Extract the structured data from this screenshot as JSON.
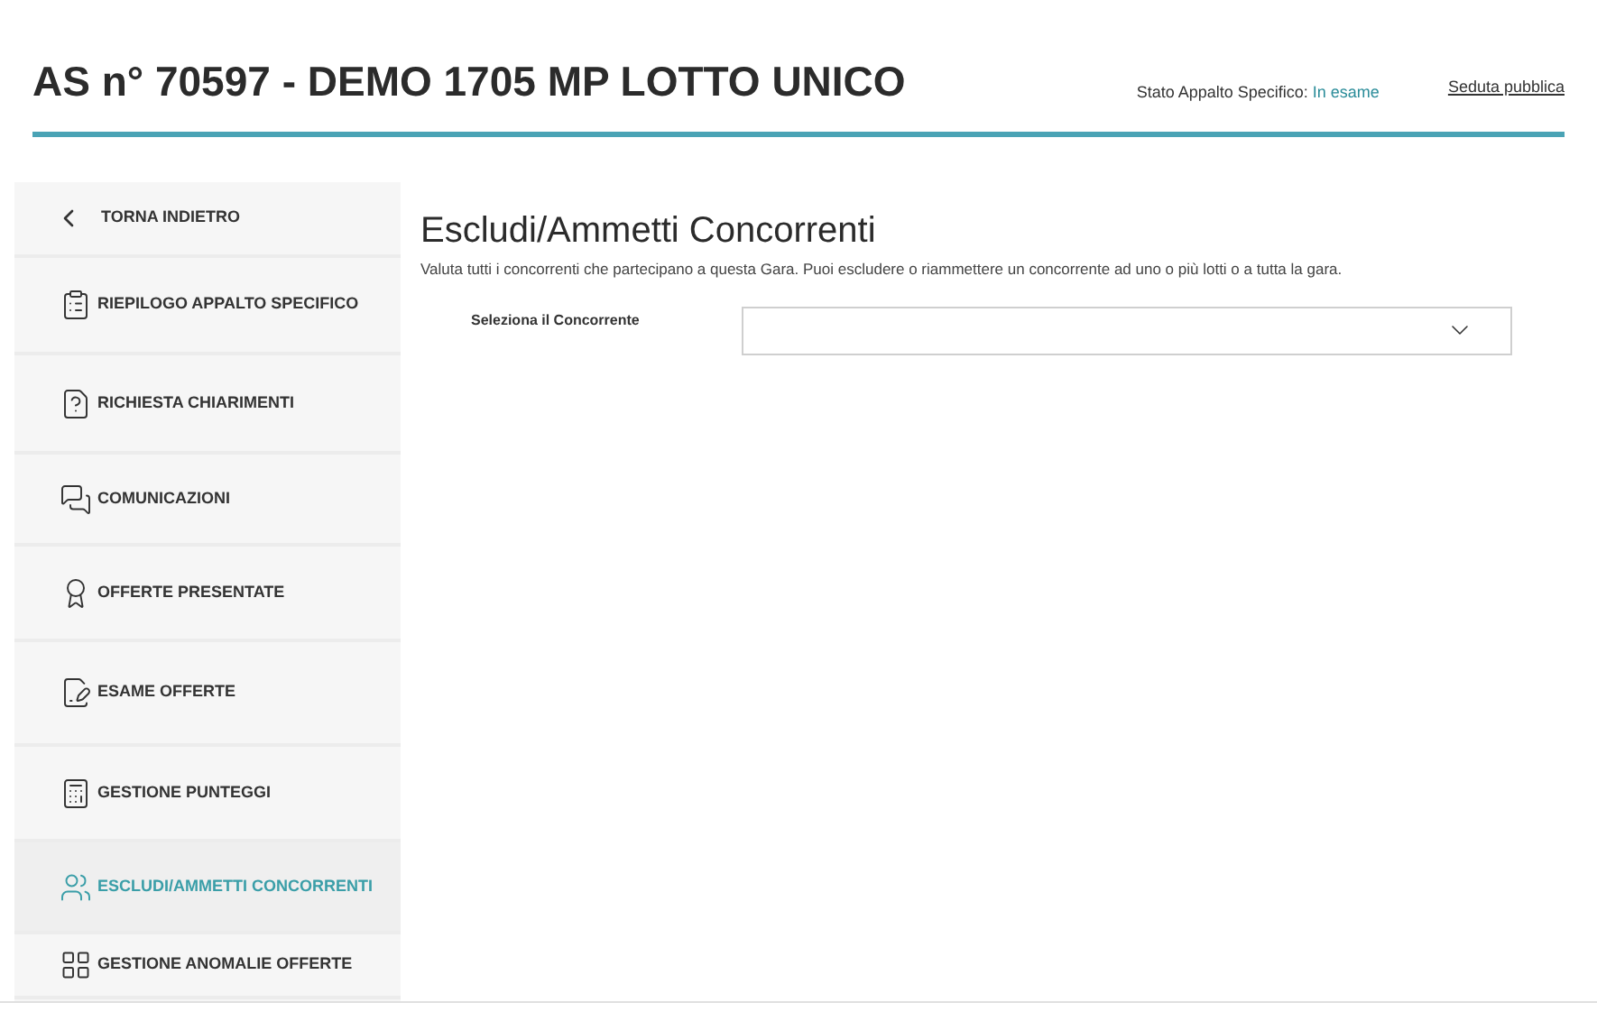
{
  "header": {
    "title": "AS n° 70597 - DEMO 1705 MP LOTTO UNICO",
    "status_label": "Stato Appalto Specifico:",
    "status_value": "In esame",
    "link": "Seduta pubblica"
  },
  "sidebar": {
    "back": "TORNA INDIETRO",
    "items": [
      {
        "label": "RIEPILOGO APPALTO SPECIFICO",
        "selected": false
      },
      {
        "label": "RICHIESTA CHIARIMENTI",
        "selected": false
      },
      {
        "label": "COMUNICAZIONI",
        "selected": false
      },
      {
        "label": "OFFERTE PRESENTATE",
        "selected": false
      },
      {
        "label": "ESAME OFFERTE",
        "selected": false
      },
      {
        "label": "GESTIONE PUNTEGGI",
        "selected": false
      },
      {
        "label": "ESCLUDI/AMMETTI CONCORRENTI",
        "selected": true
      },
      {
        "label": "GESTIONE ANOMALIE OFFERTE",
        "selected": false
      }
    ]
  },
  "content": {
    "title": "Escludi/Ammetti Concorrenti",
    "description": "Valuta tutti i concorrenti che partecipano a questa Gara. Puoi escludere o riammettere un concorrente ad uno o più lotti o a tutta la gara.",
    "field_label": "Seleziona il Concorrente"
  }
}
